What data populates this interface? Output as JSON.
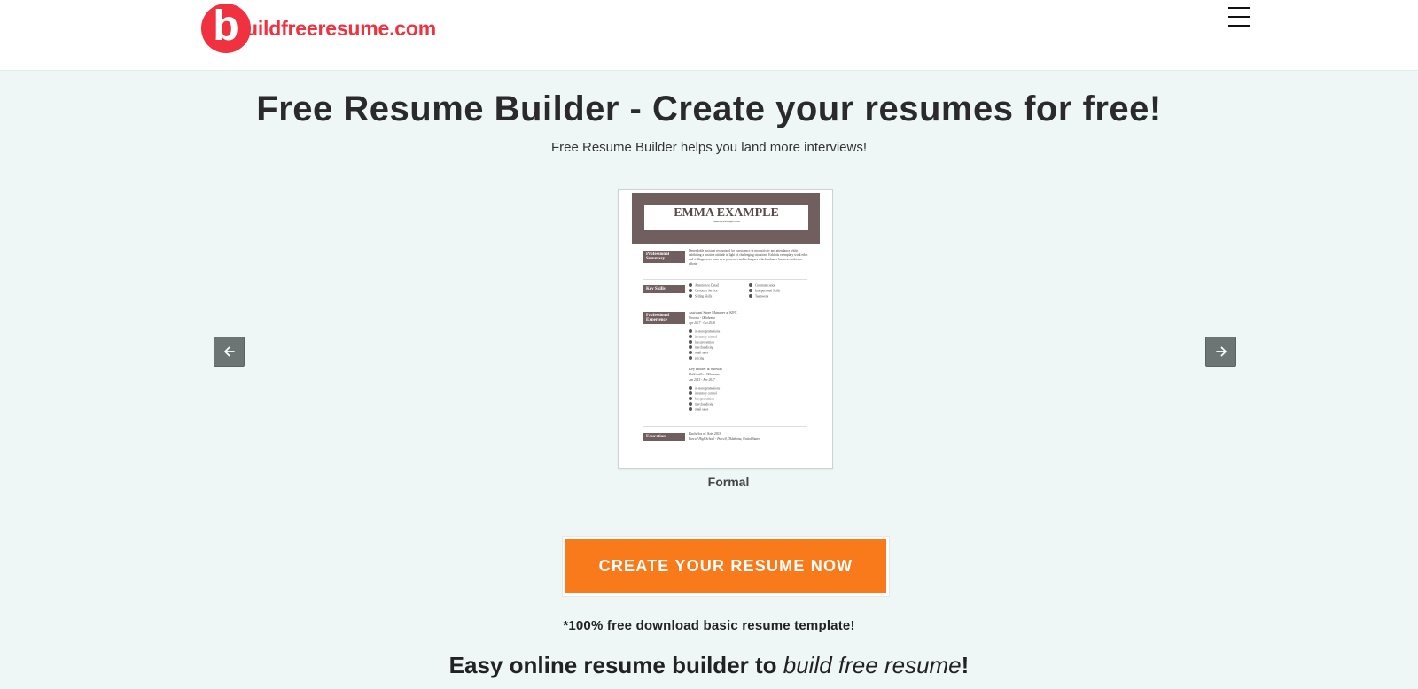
{
  "header": {
    "logo_letter": "b",
    "logo_rest": "uildfreeresume.com",
    "menu_icon": "hamburger-icon",
    "brand_color": "#f0313f"
  },
  "hero": {
    "title": "Free Resume Builder - Create your resumes for free!",
    "subtitle": "Free Resume Builder helps you land more interviews!"
  },
  "carousel": {
    "prev_icon": "arrow-left-icon",
    "next_icon": "arrow-right-icon",
    "current_template": "Formal",
    "preview": {
      "name": "EMMA EXAMPLE",
      "email": "emma@example.com",
      "summary_label": "Professional Summary",
      "summary_text": "Dependable assistant recognized for consistency in productivity and attendance while exhibiting a positive attitude in light of challenging situations. Exhibits exemplary work ethic and willingness to learn new processes and techniques which enhance business and team efforts.",
      "skills_label": "Key Skills",
      "skills_left": [
        "Attention to Detail",
        "Customer Service",
        "Selling Skills"
      ],
      "skills_right": [
        "Communication",
        "Interpersonal Skills",
        "Teamwork"
      ],
      "experience_label": "Professional Experience",
      "jobs": [
        {
          "title": "Assistant Store Manager at KFC",
          "location": "Wewoka - Oklahoma",
          "dates": "Apr 2017 - Oct 2018",
          "duties": [
            "in-store promotions",
            "inventory control",
            "loss prevention",
            "merchandising",
            "retail sales",
            "pricing"
          ]
        },
        {
          "title": "Key Holder at Subway",
          "location": "Holdenville - Oklahoma",
          "dates": "Jan 2015 - Apr 2017",
          "duties": [
            "in-store promotions",
            "inventory control",
            "loss prevention",
            "merchandising",
            "retail sales"
          ]
        }
      ],
      "education_label": "Education",
      "degree": "Bachelor of Arts 2010",
      "school": "Purcell High School - Purcell, Oklahoma, United States"
    }
  },
  "cta": {
    "button_label": "CREATE YOUR RESUME NOW",
    "button_color": "#f97a1b",
    "note": "*100% free download basic resume template!"
  },
  "tagline": {
    "prefix": "Easy online resume builder to ",
    "emphasis": "build free resume",
    "suffix": "!"
  }
}
